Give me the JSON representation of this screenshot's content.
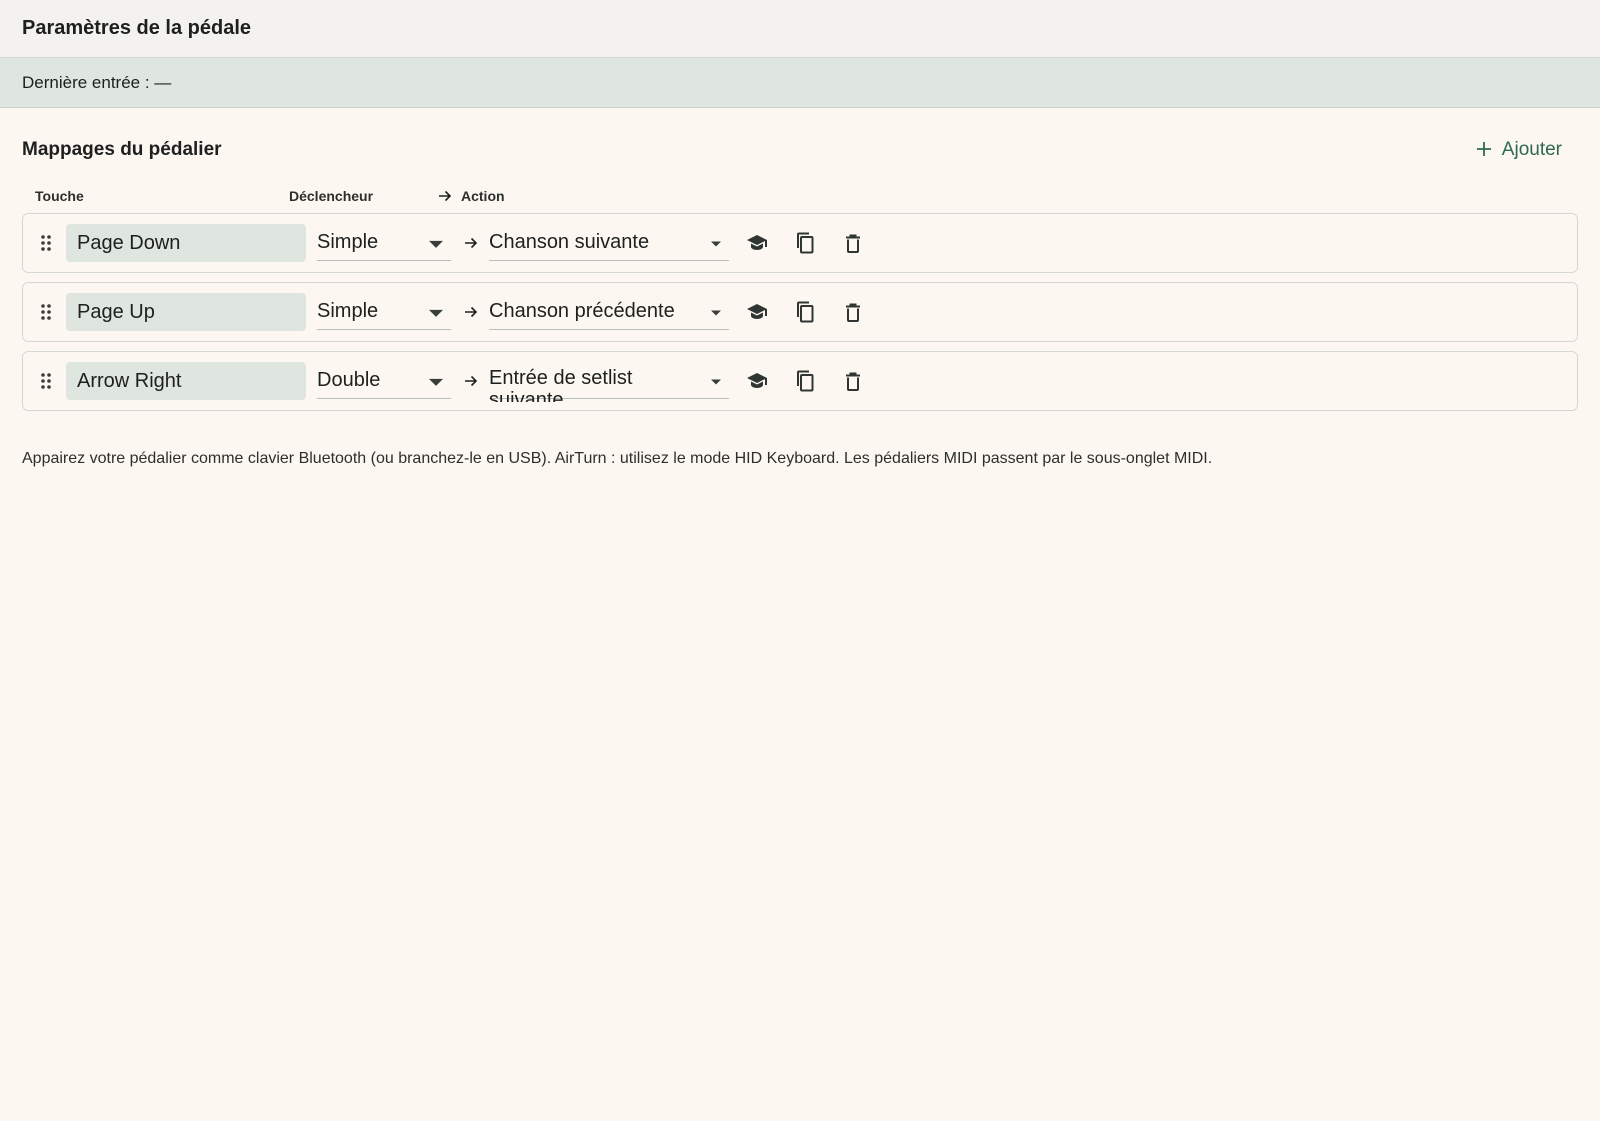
{
  "header": {
    "title": "Paramètres de la pédale"
  },
  "status": {
    "last_input": "Dernière entrée : —"
  },
  "mappings": {
    "title": "Mappages du pédalier",
    "add_label": "Ajouter",
    "columns": {
      "key": "Touche",
      "trigger": "Déclencheur",
      "action": "Action"
    },
    "rows": [
      {
        "key": "Page Down",
        "trigger": "Simple",
        "action": "Chanson suivante"
      },
      {
        "key": "Page Up",
        "trigger": "Simple",
        "action": "Chanson précédente"
      },
      {
        "key": "Arrow Right",
        "trigger": "Double",
        "action": "Entrée de setlist suivante"
      }
    ]
  },
  "help": {
    "text": "Appairez votre pédalier comme clavier Bluetooth (ou branchez-le en USB). AirTurn : utilisez le mode HID Keyboard. Les pédaliers MIDI passent par le sous-onglet MIDI."
  },
  "icons": {
    "drag": "drag-handle-icon",
    "learn": "graduation-cap-icon",
    "duplicate": "copy-icon",
    "delete": "trash-icon",
    "arrow": "arrow-right-icon",
    "add": "plus-icon"
  },
  "colors": {
    "background": "#fdf7f2",
    "header_bg": "#f3f2ee",
    "status_bg": "#dfe6df",
    "accent": "#2e6a4f",
    "field_bg": "#dfe5df"
  }
}
